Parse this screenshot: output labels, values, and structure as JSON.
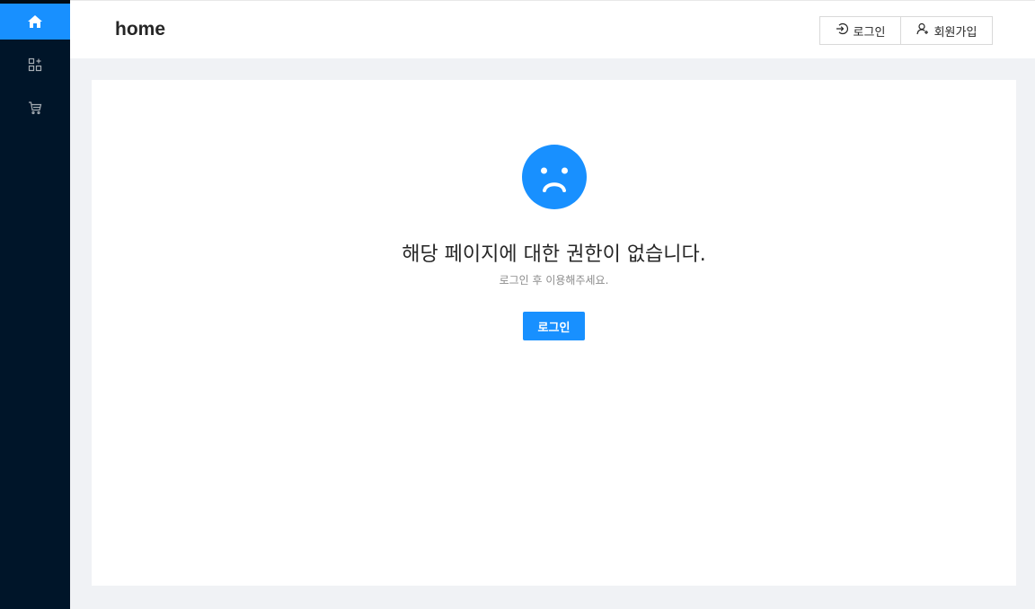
{
  "sidebar": {
    "items": [
      {
        "icon": "home-icon",
        "active": true
      },
      {
        "icon": "appstore-icon",
        "active": false
      },
      {
        "icon": "shopping-cart-icon",
        "active": false
      }
    ]
  },
  "header": {
    "title": "home",
    "login_label": "로그인",
    "signup_label": "회원가입"
  },
  "main": {
    "icon": "frown-icon",
    "title": "해당 페이지에 대한 권한이 없습니다.",
    "subtitle": "로그인 후 이용해주세요.",
    "button_label": "로그인"
  },
  "colors": {
    "sidebar_bg": "#001529",
    "accent": "#1890ff",
    "page_bg": "#f0f2f5"
  }
}
